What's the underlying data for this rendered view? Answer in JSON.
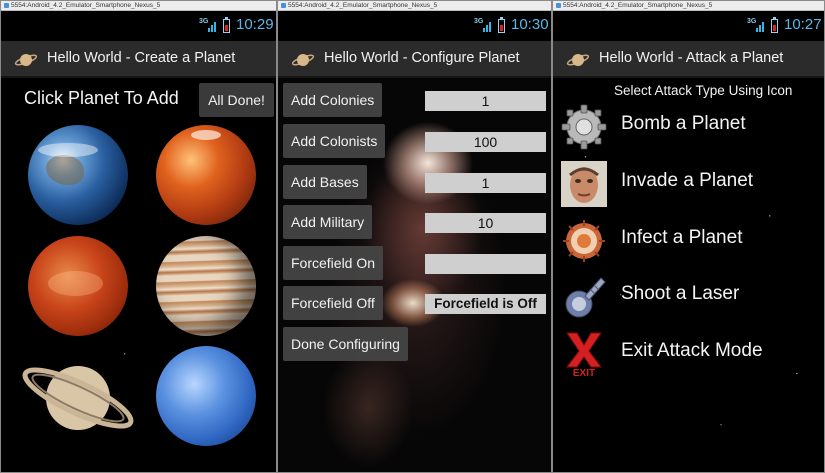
{
  "windows": [
    {
      "window_title": "5554:Android_4.2_Emulator_Smartphone_Nexus_5",
      "signal": "3G",
      "clock": "10:29",
      "app_title": "Hello World - Create a Planet",
      "instruction": "Click Planet To Add",
      "done_button": "All Done!",
      "planets": [
        "earth",
        "mars",
        "red-planet",
        "jupiter",
        "saturn",
        "neptune"
      ]
    },
    {
      "window_title": "5554:Android_4.2_Emulator_Smartphone_Nexus_5",
      "signal": "3G",
      "clock": "10:30",
      "app_title": "Hello World - Configure Planet",
      "rows": [
        {
          "button": "Add Colonies",
          "value": "1"
        },
        {
          "button": "Add Colonists",
          "value": "100"
        },
        {
          "button": "Add Bases",
          "value": "1"
        },
        {
          "button": "Add Military",
          "value": "10"
        },
        {
          "button": "Forcefield On",
          "value": ""
        },
        {
          "button": "Forcefield Off",
          "value": "Forcefield is Off"
        },
        {
          "button": "Done Configuring",
          "value": null
        }
      ]
    },
    {
      "window_title": "5554:Android_4.2_Emulator_Smartphone_Nexus_5",
      "signal": "3G",
      "clock": "10:27",
      "app_title": "Hello World - Attack a Planet",
      "header": "Select Attack Type Using Icon",
      "attacks": [
        {
          "label": "Bomb a Planet",
          "icon": "bomb-icon"
        },
        {
          "label": "Invade a Planet",
          "icon": "invader-face-icon"
        },
        {
          "label": "Infect a Planet",
          "icon": "virus-icon"
        },
        {
          "label": "Shoot a Laser",
          "icon": "laser-cannon-icon"
        },
        {
          "label": "Exit Attack Mode",
          "icon": "exit-icon",
          "icon_text": "EXIT"
        }
      ]
    }
  ],
  "colors": {
    "status_clock": "#5ab8e6",
    "action_bar": "#2b2b2b",
    "field_bg": "#cfcfcf",
    "exit_red": "#d42020"
  }
}
